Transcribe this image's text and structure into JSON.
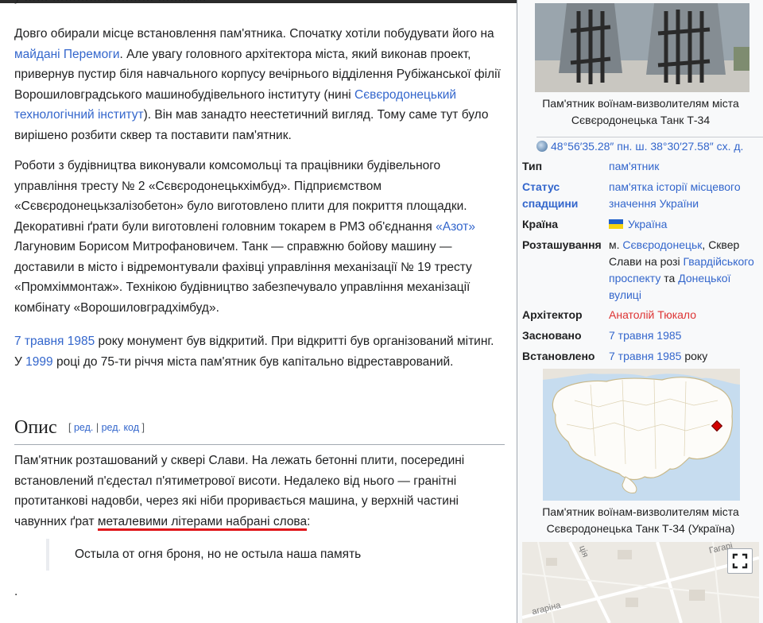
{
  "article": {
    "p1": {
      "t1": "Довго обирали місце встановлення пам'ятника. Спочатку хотіли побудувати його на ",
      "l1": "майдані Перемоги",
      "t2": ". Але увагу головного архітектора міста, який виконав проект, привернув пустир біля навчального корпусу вечірнього відділення Рубіжанської філії Ворошиловградського машинобудівельного інституту (нині ",
      "l2": "Сєвєродонецький технологічний інститут",
      "t3": "). Він мав занадто неестетичний вигляд. Тому саме тут було вирішено розбити сквер та поставити пам'ятник."
    },
    "p2": {
      "t1": "Роботи з будівництва виконували комсомольці та працівники будівельного управління тресту № 2 «Сєвєродонецькхімбуд». Підприємством «Сєвєродонецькзалізобетон» було виготовлено плити для покриття площадки. Декоративні ґрати були виготовлені головним токарем в РМЗ об'єднання ",
      "l1": "«Азот»",
      "t2": " Лагуновим Борисом Митрофановичем. Танк — справжню бойову машину — доставили в місто і відремонтували фахівці управління механізації № 19 тресту «Промхіммонтаж». Технікою будівництво забезпечувало управління механізації комбінату «Ворошиловградхімбуд»."
    },
    "p3": {
      "l1": "7 травня 1985",
      "t1": " року монумент був відкритий. При відкритті був організований мітинг. У ",
      "l2": "1999",
      "t2": " році до 75-ти річчя міста пам'ятник був капітально відреставрований."
    },
    "section": {
      "title": "Опис",
      "open": "[",
      "edit": "ред.",
      "sep": "|",
      "edit_code": "ред. код",
      "close": "]"
    },
    "p4": {
      "t1": "Пам'ятник розташований у сквері Слави. На лежать бетонні плити, посередині встановлений п'єдестал п'ятиметрової висоти. Недалеко від нього — гранітні протитанкові надовби, через які ніби проривається машина, у верхній частині чавунних ґрат ",
      "hl": "металевими літерами набрані слова",
      "t2": ":"
    },
    "quote": "Остыла от огня броня, но не остыла наша память",
    "after_quote": "."
  },
  "infobox": {
    "photo_caption": "Пам'ятник воїнам-визволителям міста Сєвєродонецька Танк Т-34",
    "coords": "48°56′35.28″ пн. ш. 38°30′27.58″ сх. д.",
    "rows": {
      "type": {
        "label": "Тип",
        "value": "пам'ятник"
      },
      "status": {
        "label": "Статус спадщини",
        "value": "пам'ятка історії місцевого значення України"
      },
      "country": {
        "label": "Країна",
        "value": "Україна"
      },
      "location": {
        "label": "Розташування",
        "t1": "м. ",
        "l1": "Сєвєродонецьк",
        "t2": ", Сквер Слави на розі ",
        "l2": "Гвардійського проспекту",
        "t3": " та ",
        "l3": "Донецької вулиці"
      },
      "architect": {
        "label": "Архітектор",
        "value": "Анатолій Тюкало"
      },
      "founded": {
        "label": "Засновано",
        "value": "7 травня 1985"
      },
      "installed": {
        "label": "Встановлено",
        "value": "7 травня 1985",
        "suffix": " року"
      }
    },
    "map_caption": "Пам'ятник воїнам-визволителям міста Сєвєродонецька Танк Т-34 (Україна)",
    "street_labels": [
      "Гагарі",
      "агаріна",
      "ція"
    ]
  },
  "colors": {
    "link": "#3366cc",
    "redlink": "#d33",
    "annotation": "#e0161a",
    "marker": "#d20000"
  }
}
